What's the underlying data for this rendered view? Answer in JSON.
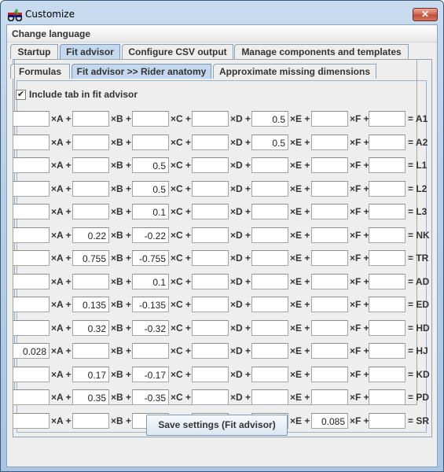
{
  "window": {
    "title": "Customize",
    "app_icon": "cyclist-icon",
    "close_glyph": "✕"
  },
  "menu": {
    "items": [
      {
        "label": "Change language"
      }
    ]
  },
  "tabs": [
    {
      "label": "Startup",
      "selected": false
    },
    {
      "label": "Fit advisor",
      "selected": true
    },
    {
      "label": "Configure CSV output",
      "selected": false
    },
    {
      "label": "Manage components and templates",
      "selected": false
    }
  ],
  "subtabs": [
    {
      "label": "Formulas",
      "selected": false
    },
    {
      "label": "Fit advisor >> Rider anatomy",
      "selected": true
    },
    {
      "label": "Approximate missing dimensions",
      "selected": false
    }
  ],
  "include_checkbox": {
    "label": "Include tab in fit advisor",
    "checked": true,
    "glyph": "✔"
  },
  "operators": {
    "A": "×A +",
    "B": "×B +",
    "C": "×C +",
    "D": "×D +",
    "E": "×E +",
    "F": "×F +"
  },
  "formulas": [
    {
      "result": "= A1",
      "values": [
        "",
        "",
        "",
        "",
        "0.5",
        "",
        ""
      ]
    },
    {
      "result": "= A2",
      "values": [
        "",
        "",
        "",
        "",
        "0.5",
        "",
        ""
      ]
    },
    {
      "result": "= L1",
      "values": [
        "",
        "",
        "0.5",
        "",
        "",
        "",
        ""
      ]
    },
    {
      "result": "= L2",
      "values": [
        "",
        "",
        "0.5",
        "",
        "",
        "",
        ""
      ]
    },
    {
      "result": "= L3",
      "values": [
        "",
        "",
        "0.1",
        "",
        "",
        "",
        ""
      ]
    },
    {
      "result": "= NK",
      "values": [
        "",
        "0.22",
        "-0.22",
        "",
        "",
        "",
        ""
      ]
    },
    {
      "result": "= TR",
      "values": [
        "",
        "0.755",
        "-0.755",
        "",
        "",
        "",
        ""
      ]
    },
    {
      "result": "= AD",
      "values": [
        "",
        "",
        "0.1",
        "",
        "",
        "",
        ""
      ]
    },
    {
      "result": "= ED",
      "values": [
        "",
        "0.135",
        "-0.135",
        "",
        "",
        "",
        ""
      ]
    },
    {
      "result": "= HD",
      "values": [
        "",
        "0.32",
        "-0.32",
        "",
        "",
        "",
        ""
      ]
    },
    {
      "result": "= HJ",
      "values": [
        "0.028",
        "",
        "",
        "",
        "",
        "",
        ""
      ]
    },
    {
      "result": "= KD",
      "values": [
        "",
        "0.17",
        "-0.17",
        "",
        "",
        "",
        ""
      ]
    },
    {
      "result": "= PD",
      "values": [
        "",
        "0.35",
        "-0.35",
        "",
        "",
        "",
        ""
      ]
    },
    {
      "result": "= SR",
      "values": [
        "",
        "",
        "",
        "",
        "",
        "0.085",
        ""
      ]
    }
  ],
  "save_button": {
    "label": "Save settings (Fit advisor)"
  }
}
